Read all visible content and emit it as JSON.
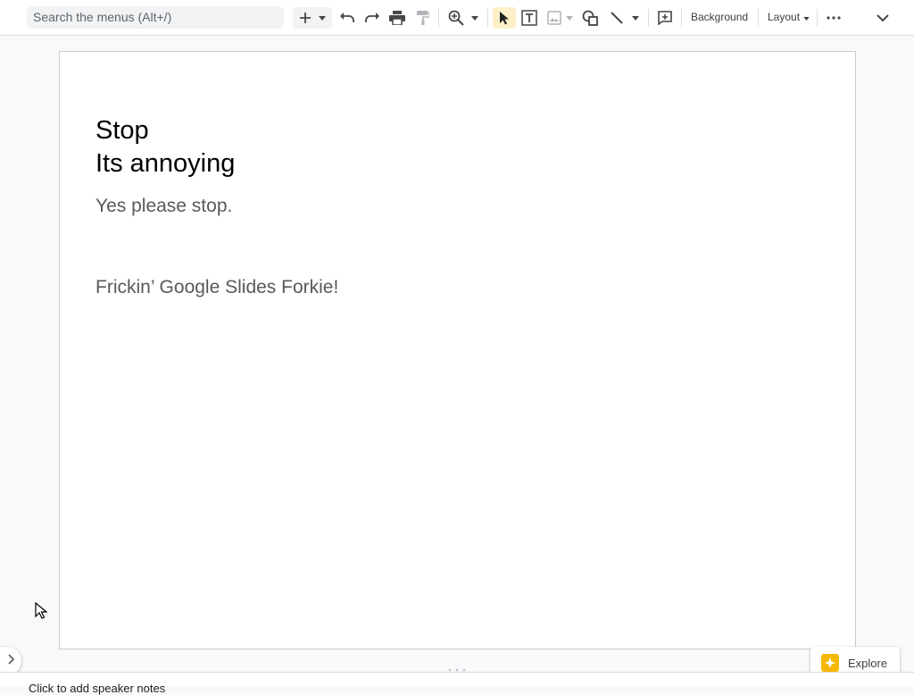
{
  "toolbar": {
    "search_placeholder": "Search the menus (Alt+/)",
    "background_label": "Background",
    "layout_label": "Layout"
  },
  "slide": {
    "title_line1": "Stop",
    "title_line2": "Its annoying",
    "subtitle": "Yes please stop.",
    "body": "Frickin’ Google Slides Forkie!"
  },
  "explore": {
    "label": "Explore"
  },
  "notes": {
    "placeholder": "Click to add speaker notes"
  },
  "colors": {
    "accent_yellow": "#f5b800",
    "select_highlight": "#fdf0c9"
  }
}
